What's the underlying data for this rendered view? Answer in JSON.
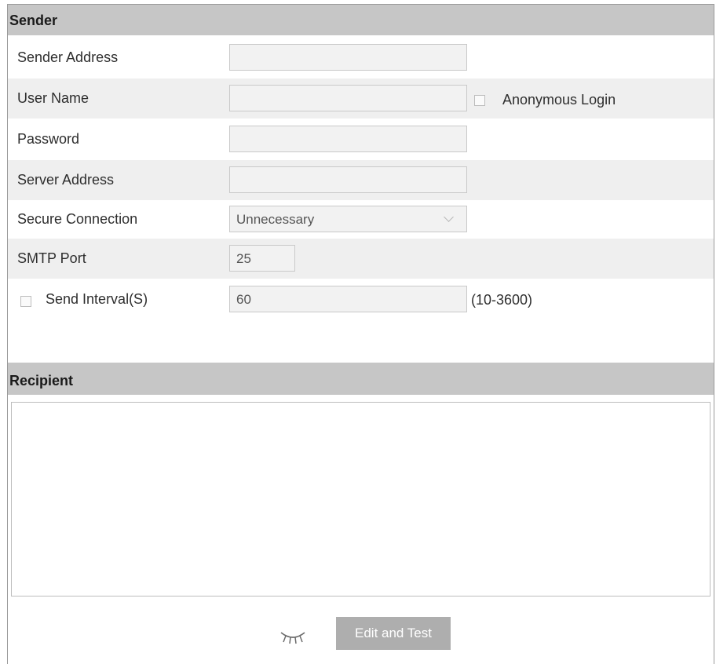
{
  "sender": {
    "header": "Sender",
    "sender_address": {
      "label": "Sender Address",
      "value": ""
    },
    "user_name": {
      "label": "User Name",
      "value": "",
      "anonymous_label": "Anonymous Login",
      "anonymous_checked": false
    },
    "password": {
      "label": "Password",
      "value": ""
    },
    "server_address": {
      "label": "Server Address",
      "value": ""
    },
    "secure_connection": {
      "label": "Secure Connection",
      "selected": "Unnecessary"
    },
    "smtp_port": {
      "label": "SMTP Port",
      "value": "25"
    },
    "send_interval": {
      "label": "Send Interval(S)",
      "checked": false,
      "value": "60",
      "range": "(10-3600)"
    }
  },
  "recipient": {
    "header": "Recipient",
    "list": ""
  },
  "actions": {
    "edit_and_test_label": "Edit and Test",
    "visibility_icon": "eye-closed-icon"
  }
}
